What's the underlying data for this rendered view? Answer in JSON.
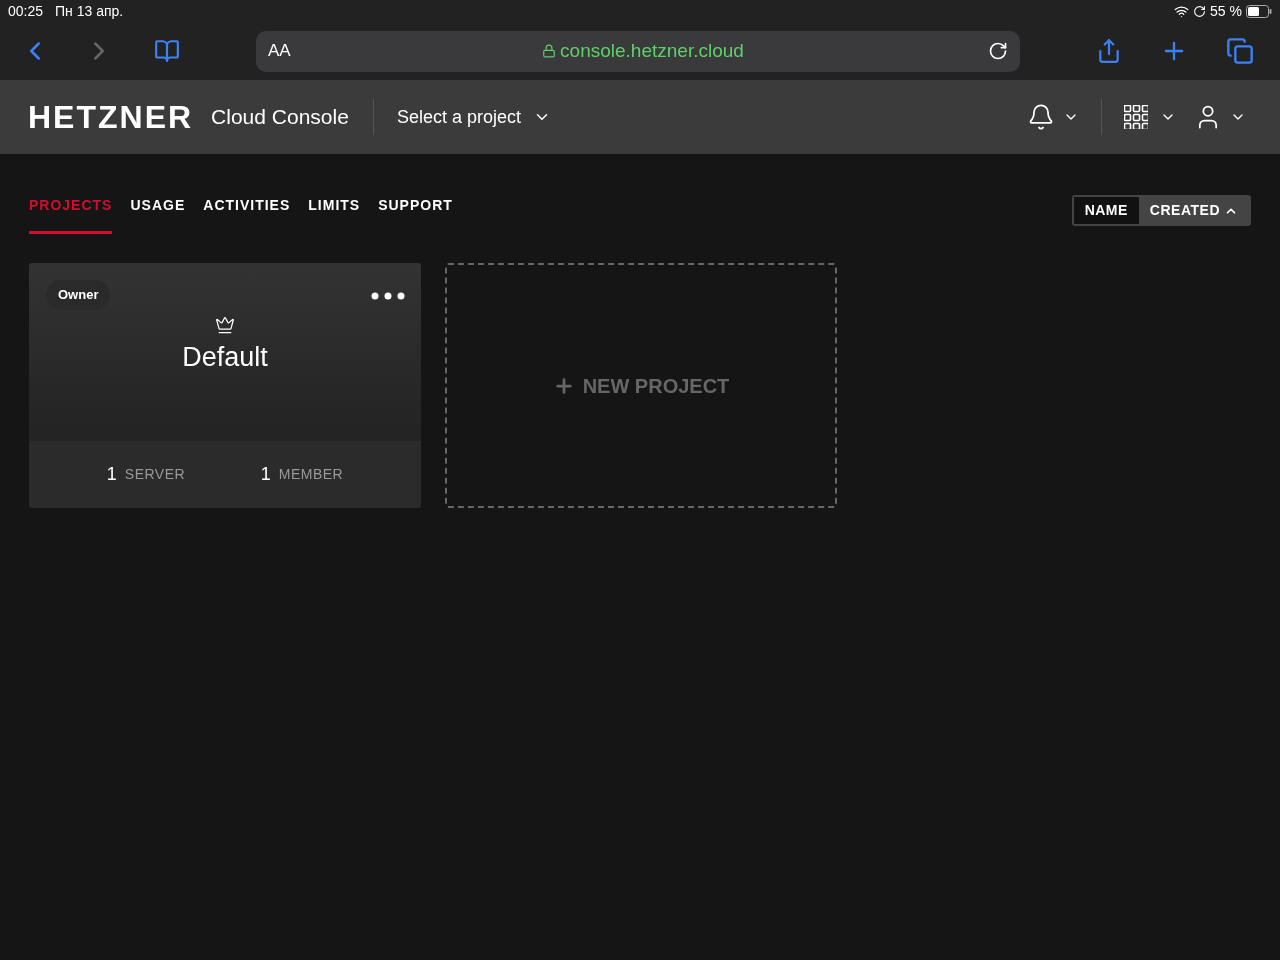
{
  "status_bar": {
    "time": "00:25",
    "date": "Пн 13 апр.",
    "battery": "55 %"
  },
  "browser": {
    "text_size": "AA",
    "url": "console.hetzner.cloud",
    "secure": true
  },
  "header": {
    "logo": "HETZNER",
    "product": "Cloud Console",
    "project_select": "Select a project"
  },
  "tabs": [
    {
      "label": "PROJECTS",
      "selected": true
    },
    {
      "label": "USAGE",
      "selected": false
    },
    {
      "label": "ACTIVITIES",
      "selected": false
    },
    {
      "label": "LIMITS",
      "selected": false
    },
    {
      "label": "SUPPORT",
      "selected": false
    }
  ],
  "sort": [
    {
      "label": "NAME",
      "selected": false
    },
    {
      "label": "CREATED",
      "selected": true
    }
  ],
  "projects": [
    {
      "role": "Owner",
      "name": "Default",
      "servers_count": "1",
      "servers_label": "SERVER",
      "members_count": "1",
      "members_label": "MEMBER"
    }
  ],
  "new_project": "NEW PROJECT"
}
